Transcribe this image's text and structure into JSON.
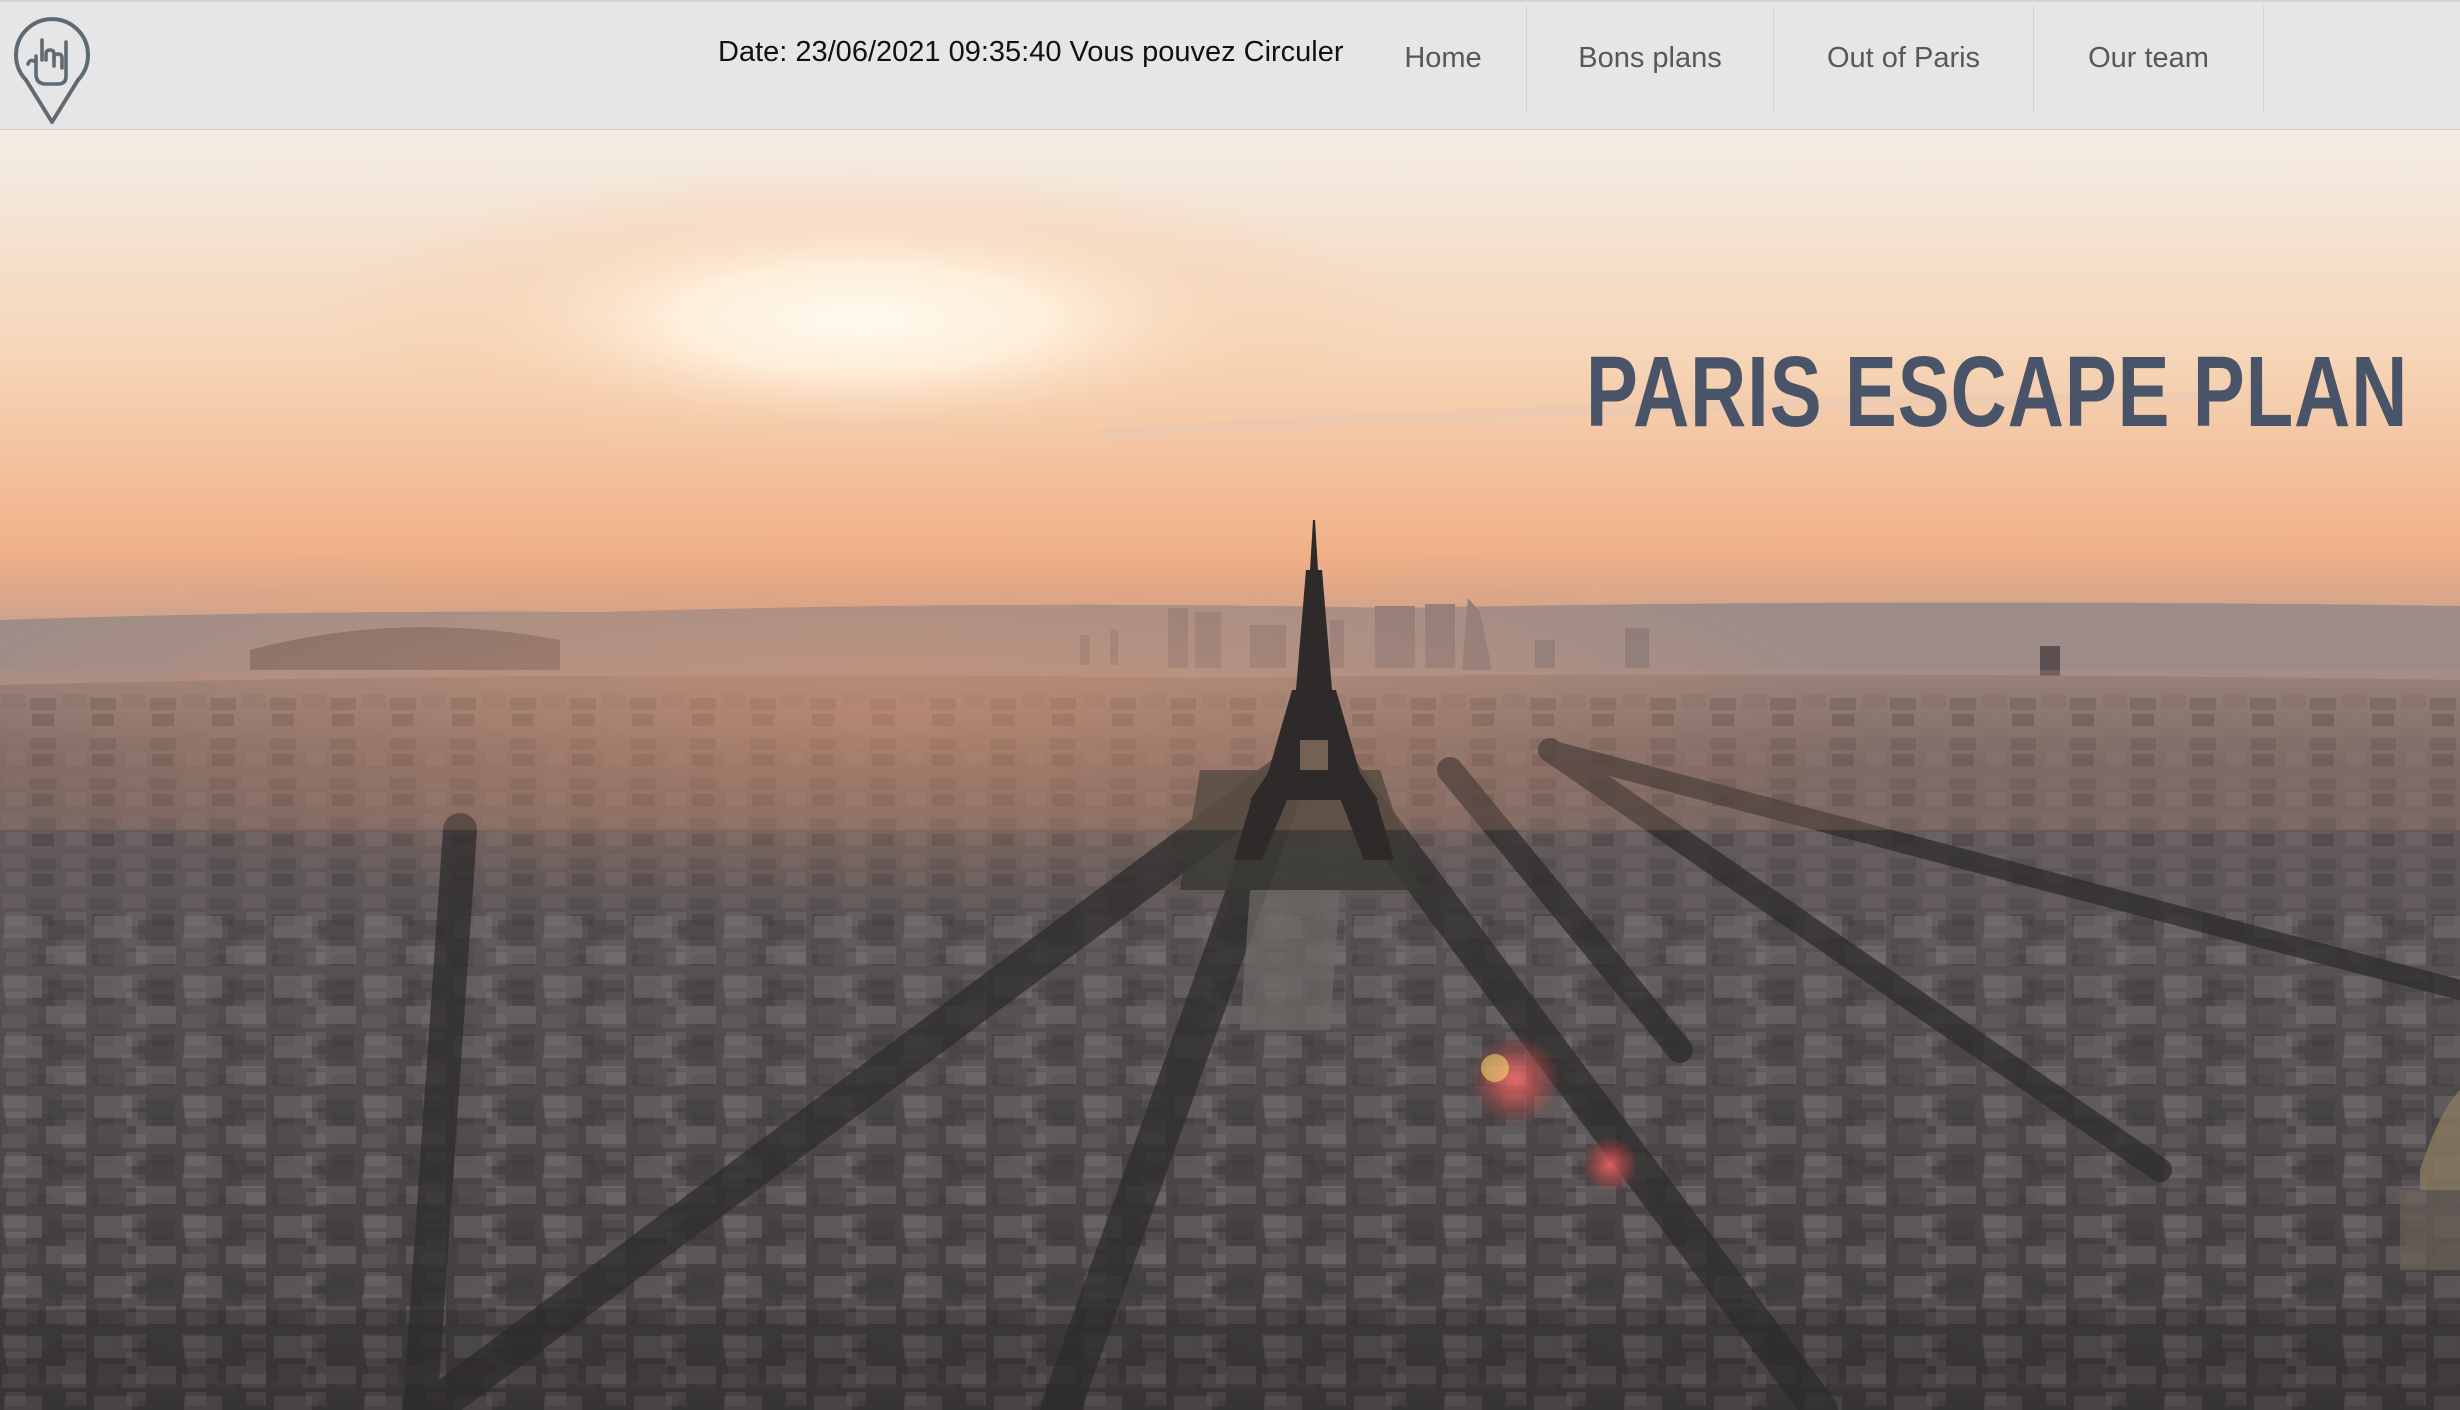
{
  "header": {
    "logo_icon": "rock-hand-location-pin-icon",
    "date_status": "Date: 23/06/2021 09:35:40 Vous pouvez Circuler"
  },
  "nav": {
    "items": [
      {
        "label": "Home"
      },
      {
        "label": "Bons plans"
      },
      {
        "label": "Out of Paris"
      },
      {
        "label": "Our team"
      }
    ]
  },
  "hero": {
    "title": "PARIS ESCAPE PLAN",
    "title_color": "#4a5468",
    "image_subject": "aerial-paris-sunset-eiffel-tower-image"
  }
}
